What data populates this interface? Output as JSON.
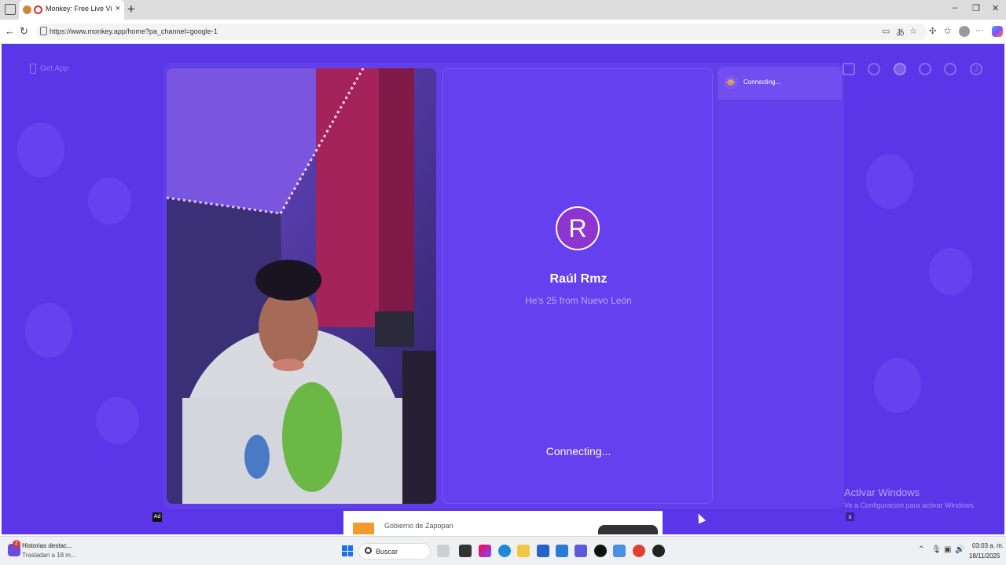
{
  "browser": {
    "tab_title": "Monkey: Free Live Video Cha",
    "tab_close": "×",
    "new_tab": "+",
    "url": "https://www.monkey.app/home?pa_channel=google-1",
    "minimize": "–",
    "restore": "❐",
    "close": "✕",
    "more": "···"
  },
  "page": {
    "get_app_label": "Get App",
    "top_avatar_letter": "J",
    "peer": {
      "avatar_letter": "R",
      "name": "Raúl Rmz",
      "subtitle": "He's 25 from Nuevo León",
      "status": "Connecting..."
    },
    "chat_list": [
      {
        "icon": "monkey-icon",
        "status": "Connecting..."
      }
    ],
    "ad": {
      "tag": "Ad",
      "advertiser": "Gobierno de Zapopan"
    },
    "watermark": {
      "title": "Activar Windows",
      "subtitle": "Ve a Configuración para activar Windows.",
      "close": "x"
    }
  },
  "taskbar": {
    "news_badge": "2",
    "news_title": "Historias destac...",
    "news_sub": "Trasladan a 18 m...",
    "search_placeholder": "Buscar",
    "time": "03:03 a. m.",
    "date": "18/11/2025"
  }
}
